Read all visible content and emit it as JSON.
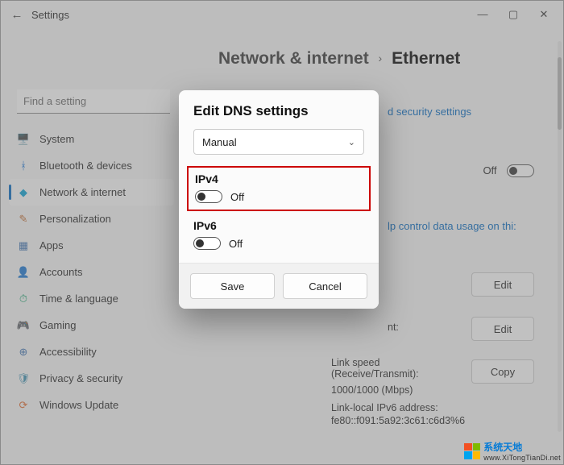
{
  "window": {
    "title": "Settings"
  },
  "breadcrumb": {
    "parent": "Network & internet",
    "current": "Ethernet"
  },
  "search": {
    "placeholder": "Find a setting"
  },
  "sidebar": [
    {
      "icon": "🖥️",
      "label": "System",
      "color": "#3a6fb0"
    },
    {
      "icon": "ᚼ",
      "label": "Bluetooth & devices",
      "color": "#0a6cd6"
    },
    {
      "icon": "◆",
      "label": "Network & internet",
      "color": "#07a0d4",
      "selected": true
    },
    {
      "icon": "✎",
      "label": "Personalization",
      "color": "#c06a2e"
    },
    {
      "icon": "▦",
      "label": "Apps",
      "color": "#3a6fb0"
    },
    {
      "icon": "👤",
      "label": "Accounts",
      "color": "#3a8fb0"
    },
    {
      "icon": "⏱",
      "label": "Time & language",
      "color": "#12a06a"
    },
    {
      "icon": "🎮",
      "label": "Gaming",
      "color": "#4a6a8a"
    },
    {
      "icon": "⊕",
      "label": "Accessibility",
      "color": "#3a6fb0"
    },
    {
      "icon": "🛡",
      "label": "Privacy & security",
      "color": "#3a8fb0"
    },
    {
      "icon": "⟳",
      "label": "Windows Update",
      "color": "#e06a2e"
    }
  ],
  "main": {
    "security_link": "d security settings",
    "metered_off": "Off",
    "metered_hint": "lp control data usage on thi:",
    "dns_label": "nt:",
    "edit": "Edit",
    "copy": "Copy",
    "linkspeed_label": "Link speed (Receive/Transmit):",
    "linkspeed_value": "1000/1000 (Mbps)",
    "linklocal_label": "Link-local IPv6 address:",
    "linklocal_value": "fe80::f091:5a92:3c61:c6d3%6"
  },
  "dialog": {
    "title": "Edit DNS settings",
    "mode": "Manual",
    "ipv4_label": "IPv4",
    "ipv4_state": "Off",
    "ipv6_label": "IPv6",
    "ipv6_state": "Off",
    "save": "Save",
    "cancel": "Cancel"
  },
  "watermark": {
    "cn": "系统天地",
    "url": "www.XiTongTianDi.net"
  }
}
